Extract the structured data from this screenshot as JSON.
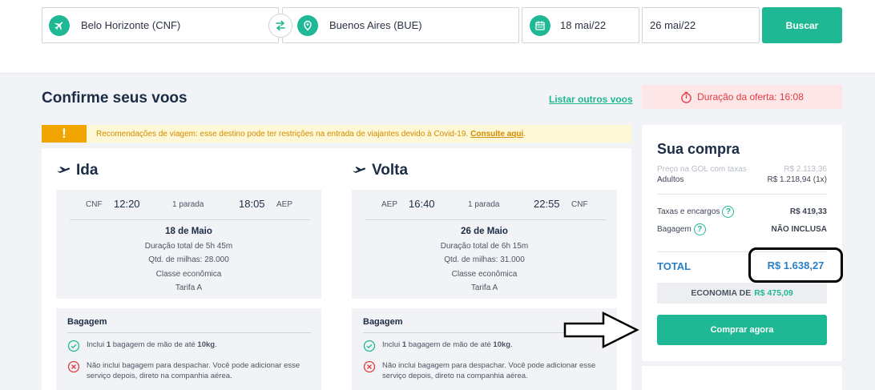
{
  "search": {
    "origin": "Belo Horizonte (CNF)",
    "destination": "Buenos Aires (BUE)",
    "depart_date": "18 mai/22",
    "return_date": "26 mai/22",
    "search_button": "Buscar"
  },
  "header": {
    "title": "Confirme seus voos",
    "other_flights_link": "Listar outros voos",
    "offer_duration": "Duração da oferta: 16:08"
  },
  "alert": {
    "mark": "!",
    "text": "Recomendações de viagem: esse destino pode ter restrições na entrada de viajantes devido à Covid-19.",
    "link": "Consulte aqui",
    "end": "."
  },
  "legs": [
    {
      "title": "Ida",
      "from_code": "CNF",
      "depart_time": "12:20",
      "stops": "1 parada",
      "arrive_time": "18:05",
      "to_code": "AEP",
      "date": "18 de Maio",
      "duration": "Duração total de 5h 45m",
      "miles": "Qtd. de milhas: 28.000",
      "cabin": "Classe econômica",
      "fare": "Tarifa A"
    },
    {
      "title": "Volta",
      "from_code": "AEP",
      "depart_time": "16:40",
      "stops": "1 parada",
      "arrive_time": "22:55",
      "to_code": "CNF",
      "date": "26 de Maio",
      "duration": "Duração total de 6h 15m",
      "miles": "Qtd. de milhas: 31.000",
      "cabin": "Classe econômica",
      "fare": "Tarifa A"
    }
  ],
  "baggage": {
    "title": "Bagagem",
    "included_pre": "Inclui ",
    "included_count": "1",
    "included_mid": " bagagem de mão de até ",
    "included_weight": "10kg",
    "included_end": ".",
    "excluded": "Não inclui bagagem para despachar. Você pode adicionar esse serviço depois, direto na companhia aérea."
  },
  "summary": {
    "title": "Sua compra",
    "gol_price_label": "Preço na GOL com taxas",
    "gol_price_value": "R$ 2.113,36",
    "adults_label": "Adultos",
    "adults_value": "R$ 1.218,94 (1x)",
    "taxes_label": "Taxas e encargos",
    "taxes_value": "R$ 419,33",
    "baggage_label": "Bagagem",
    "baggage_value": "NÃO INCLUSA",
    "total_label": "TOTAL",
    "total_value": "R$ 1.638,27",
    "economy_label": "ECONOMIA DE",
    "economy_value": "R$ 475,09",
    "buy_button": "Comprar agora"
  },
  "colors": {
    "accent": "#1fb894",
    "total_blue": "#2b7fc2",
    "alert_orange": "#f0a500",
    "offer_red": "#e23a3f"
  }
}
